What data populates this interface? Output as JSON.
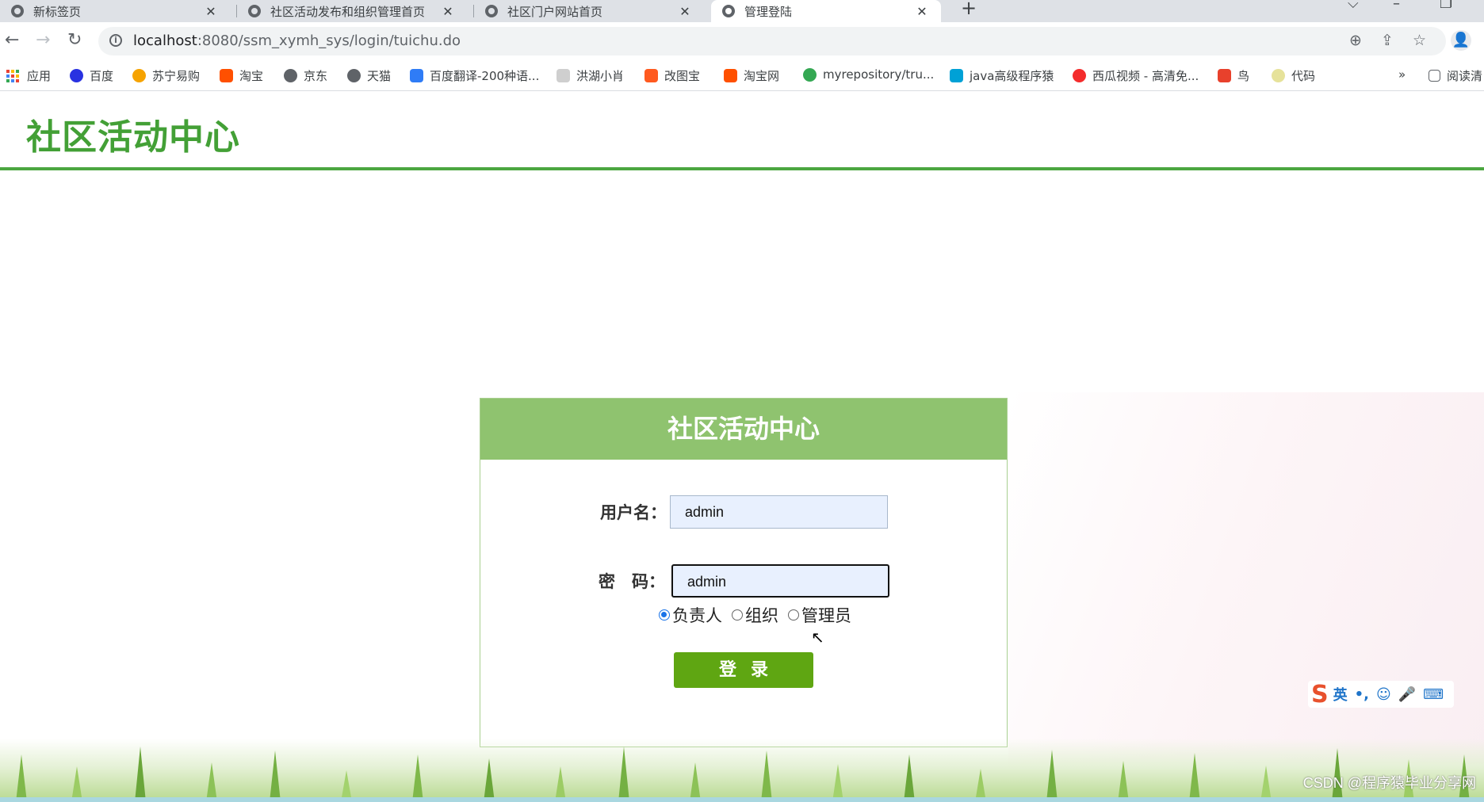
{
  "browser": {
    "tabs": [
      {
        "title": "新标签页",
        "close": "✕"
      },
      {
        "title": "社区活动发布和组织管理首页",
        "close": "✕"
      },
      {
        "title": "社区门户网站首页",
        "close": "✕"
      },
      {
        "title": "管理登陆",
        "close": "✕"
      }
    ],
    "new_tab": "+",
    "url_host": "localhost",
    "url_path": ":8080/ssm_xymh_sys/login/tuichu.do",
    "bookmarks": [
      {
        "label": "应用",
        "icon": "apps-grid-icon",
        "color": "#ea4335"
      },
      {
        "label": "百度",
        "icon": "baidu-paw-icon",
        "color": "#2932e1"
      },
      {
        "label": "苏宁易购",
        "icon": "suning-lion-icon",
        "color": "#f6a300"
      },
      {
        "label": "淘宝",
        "icon": "taobao-icon",
        "color": "#ff5000"
      },
      {
        "label": "京东",
        "icon": "globe-icon",
        "color": "#5f6368"
      },
      {
        "label": "天猫",
        "icon": "globe-icon",
        "color": "#5f6368"
      },
      {
        "label": "百度翻译-200种语...",
        "icon": "translate-icon",
        "color": "#2f7cf6"
      },
      {
        "label": "洪湖小肖",
        "icon": "feather-icon",
        "color": "#8a8a8a"
      },
      {
        "label": "改图宝",
        "icon": "gaitubao-icon",
        "color": "#ff5a1f"
      },
      {
        "label": "淘宝网",
        "icon": "taobao-icon",
        "color": "#ff5000"
      },
      {
        "label": "myrepository/tru...",
        "icon": "chrome-icon",
        "color": "#34a853"
      },
      {
        "label": "java高级程序猿",
        "icon": "bilibili-icon",
        "color": "#00a1d6"
      },
      {
        "label": "西瓜视频 - 高清免...",
        "icon": "xigua-play-icon",
        "color": "#f42c2c"
      },
      {
        "label": "鸟",
        "icon": "bird-icon",
        "color": "#e8412c"
      },
      {
        "label": "代码",
        "icon": "leaf-icon",
        "color": "#d9d36a"
      }
    ],
    "more_bookmarks": "»",
    "reading_list": "阅读清"
  },
  "site": {
    "title": "社区活动中心"
  },
  "login": {
    "heading": "社区活动中心",
    "username_label": "用户名：",
    "username_value": "admin",
    "password_label": "密　码：",
    "password_value": "admin",
    "roles": [
      {
        "label": "负责人",
        "checked": true
      },
      {
        "label": "组织",
        "checked": false
      },
      {
        "label": "管理员",
        "checked": false
      }
    ],
    "submit_label": "登录"
  },
  "ime": {
    "logo": "S",
    "mode": "英",
    "punct": "•,",
    "emoji": "☺",
    "mic": "🎤",
    "keyboard": "⌨"
  },
  "watermark": "CSDN @程序猿毕业分享网",
  "colors": {
    "site_green": "#43a036",
    "header_bar": "#8fc36f",
    "button": "#5fa612"
  }
}
